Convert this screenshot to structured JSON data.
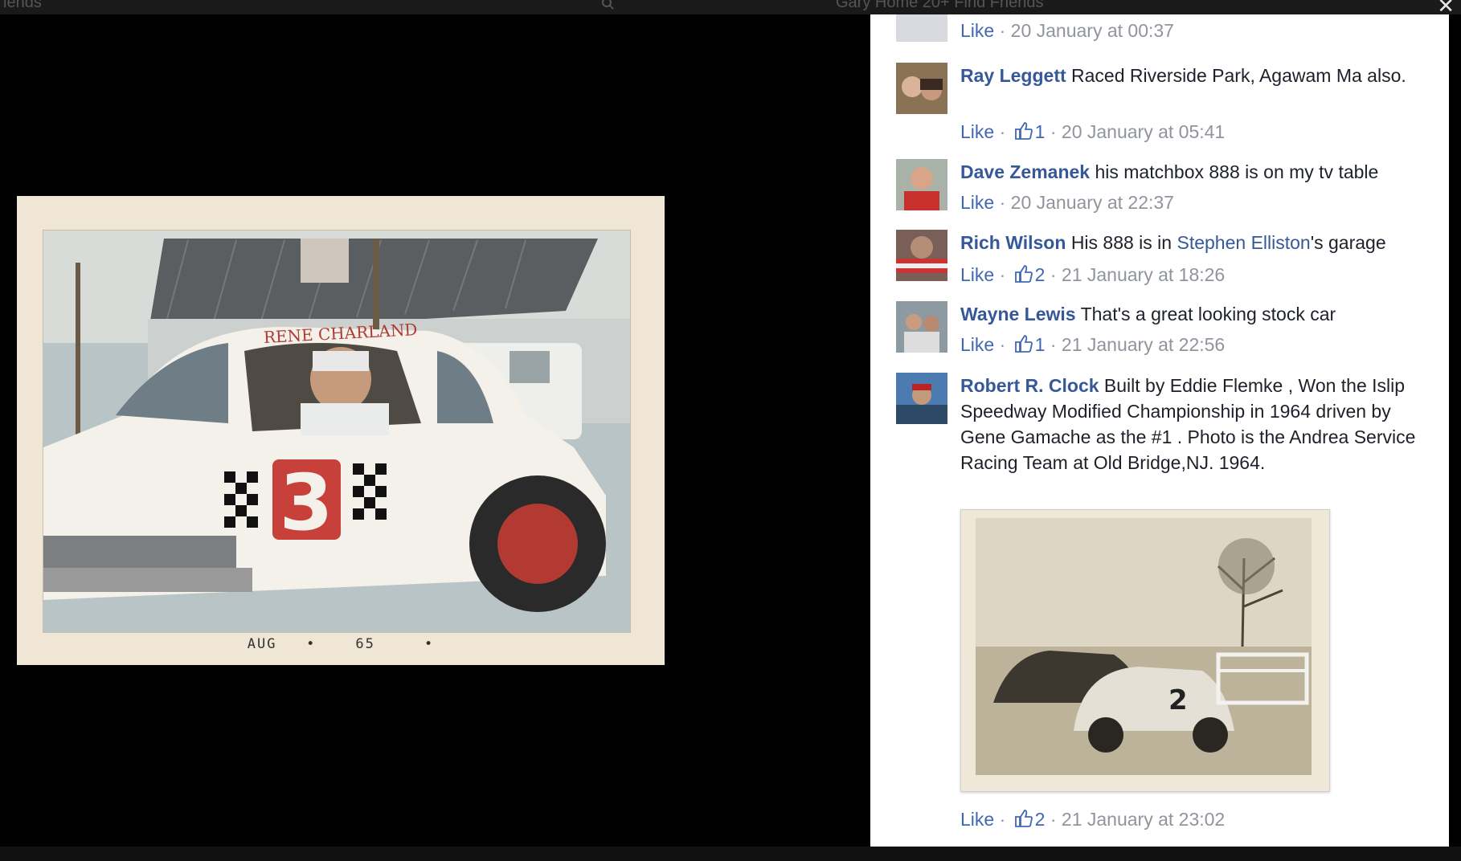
{
  "topbar": {
    "left_text": "iends",
    "mid_text": "Gary    Home 20+    Find Friends"
  },
  "close_label": "✕",
  "photo": {
    "caption_month": "AUG",
    "caption_year": "65",
    "car_number": "3",
    "car_name": "RENE CHARLAND"
  },
  "comments": [
    {
      "name": "",
      "text": "",
      "like": "Like",
      "likes": "",
      "time": "20 January at 00:37"
    },
    {
      "name": "Ray Leggett",
      "text": "Raced Riverside Park, Agawam Ma also.",
      "like": "Like",
      "likes": "1",
      "time": "20 January at 05:41"
    },
    {
      "name": "Dave Zemanek",
      "text": "his matchbox 888 is on my tv table",
      "like": "Like",
      "likes": "",
      "time": "20 January at 22:37"
    },
    {
      "name": "Rich Wilson",
      "text_before": "His 888 is in ",
      "mention": "Stephen Elliston",
      "text_after": "'s garage",
      "like": "Like",
      "likes": "2",
      "time": "21 January at 18:26"
    },
    {
      "name": "Wayne Lewis",
      "text": "That's a great looking stock car",
      "like": "Like",
      "likes": "1",
      "time": "21 January at 22:56"
    },
    {
      "name": "Robert R. Clock",
      "text": "Built by Eddie Flemke , Won the Islip Speedway Modified Championship in 1964 driven by Gene Gamache as the #1 . Photo is the Andrea Service Racing Team at Old Bridge,NJ. 1964.",
      "like": "Like",
      "likes": "2",
      "time": "21 January at 23:02"
    }
  ],
  "separator": " · ",
  "colors": {
    "link": "#365899",
    "meta": "#90949c",
    "like": "#4267b2"
  }
}
